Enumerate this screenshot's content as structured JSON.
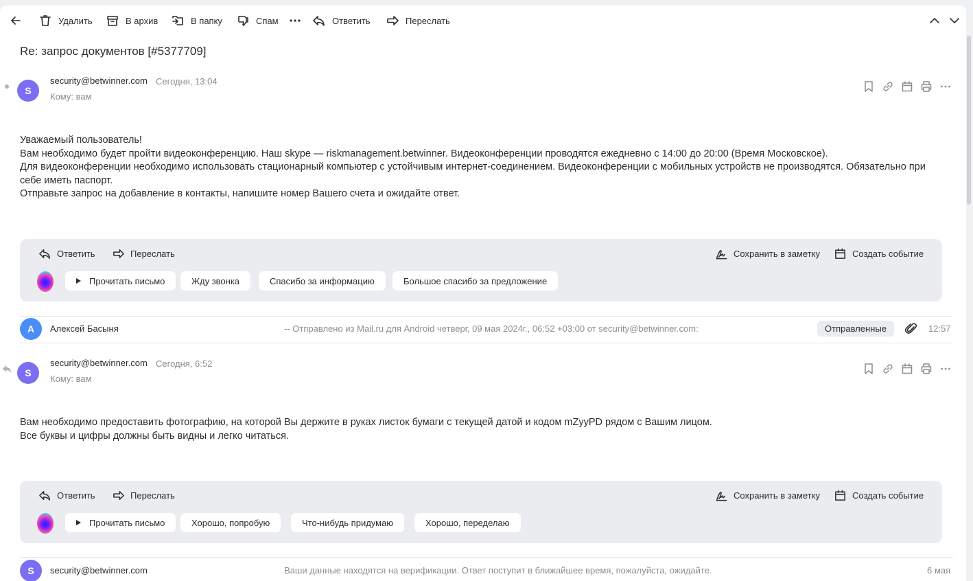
{
  "toolbar": {
    "delete": "Удалить",
    "archive": "В архив",
    "to_folder": "В папку",
    "spam": "Спам",
    "reply": "Ответить",
    "forward": "Переслать"
  },
  "subject": "Re: запрос документов [#5377709]",
  "messages": [
    {
      "avatar_letter": "S",
      "from": "security@betwinner.com",
      "date": "Сегодня, 13:04",
      "to": "Кому: вам",
      "body": [
        "Уважаемый пользователь!",
        "Вам необходимо будет пройти видеоконференцию. Наш skype — riskmanagement.betwinner. Видеоконференции проводятся ежедневно с 14:00 до 20:00 (Время Московское).",
        "Для видеоконференции необходимо использовать стационарный компьютер с устойчивым интернет-соединением. Видеоконференции с мобильных устройств не производятся. Обязательно при себе иметь паспорт.",
        "Отправьте запрос на добавление в контакты, напишите номер Вашего счета и ожидайте ответ."
      ],
      "quick": {
        "reply": "Ответить",
        "forward": "Переслать",
        "save_note": "Сохранить в заметку",
        "create_event": "Создать событие",
        "read_aloud": "Прочитать письмо",
        "suggestions": [
          "Жду звонка",
          "Спасибо за информацию",
          "Большое спасибо за предложение"
        ]
      }
    },
    {
      "avatar_letter": "S",
      "from": "security@betwinner.com",
      "date": "Сегодня, 6:52",
      "to": "Кому: вам",
      "body": [
        "Вам необходимо предоставить фотографию, на которой Вы держите в руках листок бумаги с текущей датой и кодом mZyyPD рядом с Вашим лицом.",
        "Все буквы и цифры должны быть видны и легко читаться."
      ],
      "quick": {
        "reply": "Ответить",
        "forward": "Переслать",
        "save_note": "Сохранить в заметку",
        "create_event": "Создать событие",
        "read_aloud": "Прочитать письмо",
        "suggestions": [
          "Хорошо, попробую",
          "Что-нибудь придумаю",
          "Хорошо, переделаю"
        ]
      }
    }
  ],
  "collapsed": [
    {
      "avatar_letter": "А",
      "from": "Алексей Басыня",
      "snippet": "-- Отправлено из Mail.ru для Android четверг, 09 мая 2024г., 06:52 +03:00 от security@betwinner.com:",
      "badge": "Отправленные",
      "time": "12:57"
    },
    {
      "avatar_letter": "S",
      "from": "security@betwinner.com",
      "snippet": "Ваши данные находятся на верификации. Ответ поступит в ближайшее время, пожалуйста, ожидайте.",
      "time": "6 мая"
    }
  ],
  "colors": {
    "avatar_purple": "#7c6ef0",
    "avatar_blue": "#4b8df8",
    "quick_panel_bg": "#ebecef"
  }
}
